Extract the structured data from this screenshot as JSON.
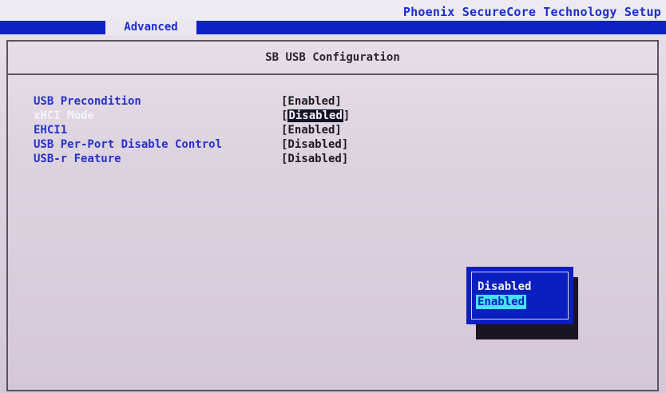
{
  "header": {
    "title": "Phoenix SecureCore Technology Setup",
    "tabs": [
      {
        "label": "Advanced",
        "active": true
      }
    ]
  },
  "page": {
    "title": "SB USB Configuration"
  },
  "settings": [
    {
      "label": "USB Precondition",
      "value": "[Enabled]"
    },
    {
      "label": "xHCI Mode",
      "value_bracket_open": "[",
      "value_inner": "Disabled",
      "value_bracket_close": "]",
      "selected": true
    },
    {
      "label": "EHCI1",
      "value": "[Enabled]"
    },
    {
      "label": "USB Per-Port Disable Control",
      "value": "[Disabled]"
    },
    {
      "label": "USB-r Feature",
      "value": "[Disabled]"
    }
  ],
  "popup": {
    "options": [
      "Disabled",
      "Enabled"
    ],
    "highlighted_index": 1
  },
  "colors": {
    "accent_blue": "#0b22c8",
    "label_blue": "#2632c8",
    "highlight_cyan": "#42e6ef",
    "background": "#ddd3df"
  }
}
